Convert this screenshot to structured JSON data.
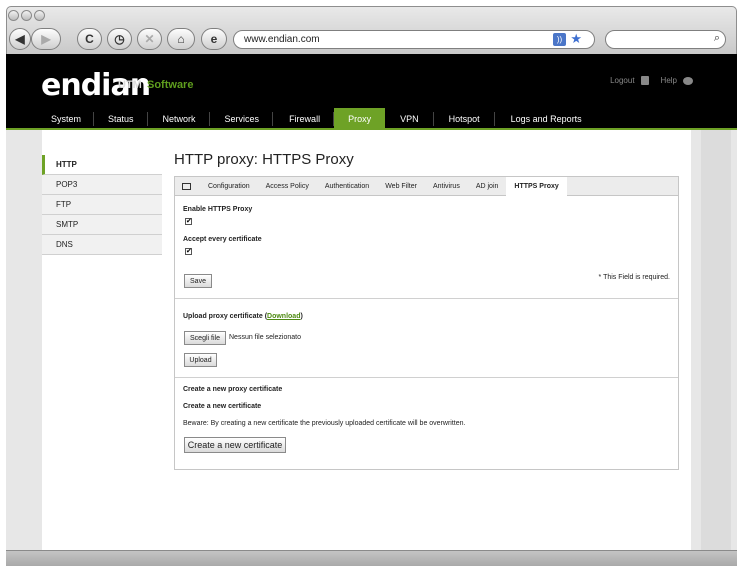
{
  "browser": {
    "url": "www.endian.com",
    "nav_glyphs": {
      "back": "◀",
      "forward": "▶",
      "reload": "C",
      "history": "◷",
      "stop": "✕",
      "home": "⌂",
      "site_icon": "e"
    },
    "search_icon": "magnifier-icon",
    "search_glyph": "⌕"
  },
  "header": {
    "logo": "endian",
    "logo_utm": "UTM",
    "logo_software": "Software",
    "logout": "Logout",
    "help": "Help"
  },
  "main_nav": {
    "items": [
      "System",
      "Status",
      "Network",
      "Services",
      "Firewall",
      "Proxy",
      "VPN",
      "Hotspot",
      "Logs and Reports"
    ],
    "active": "Proxy",
    "accent_color": "#6ea226"
  },
  "sidebar": {
    "items": [
      "HTTP",
      "POP3",
      "FTP",
      "SMTP",
      "DNS"
    ],
    "active": "HTTP"
  },
  "page": {
    "title": "HTTP proxy: HTTPS Proxy"
  },
  "tabs": {
    "items": [
      "Configuration",
      "Access Policy",
      "Authentication",
      "Web Filter",
      "Antivirus",
      "AD join",
      "HTTPS Proxy"
    ],
    "active": "HTTPS Proxy"
  },
  "form": {
    "enable_label": "Enable HTTPS Proxy",
    "enable_checked": true,
    "accept_label": "Accept every certificate",
    "accept_checked": true,
    "check_glyph": "✔",
    "save_label": "Save",
    "required_note": "* This Field is required.",
    "upload_label_prefix": "Upload proxy certificate (",
    "download_link": "Download",
    "upload_label_suffix": ")",
    "choose_file_label": "Scegli file",
    "no_file_text": "Nessun file selezionato",
    "upload_button": "Upload",
    "create_heading": "Create a new proxy certificate",
    "create_subheading": "Create a new certificate",
    "warning_text": "Beware: By creating a new certificate the previously uploaded certificate will be overwritten.",
    "create_button": "Create a new certificate"
  }
}
